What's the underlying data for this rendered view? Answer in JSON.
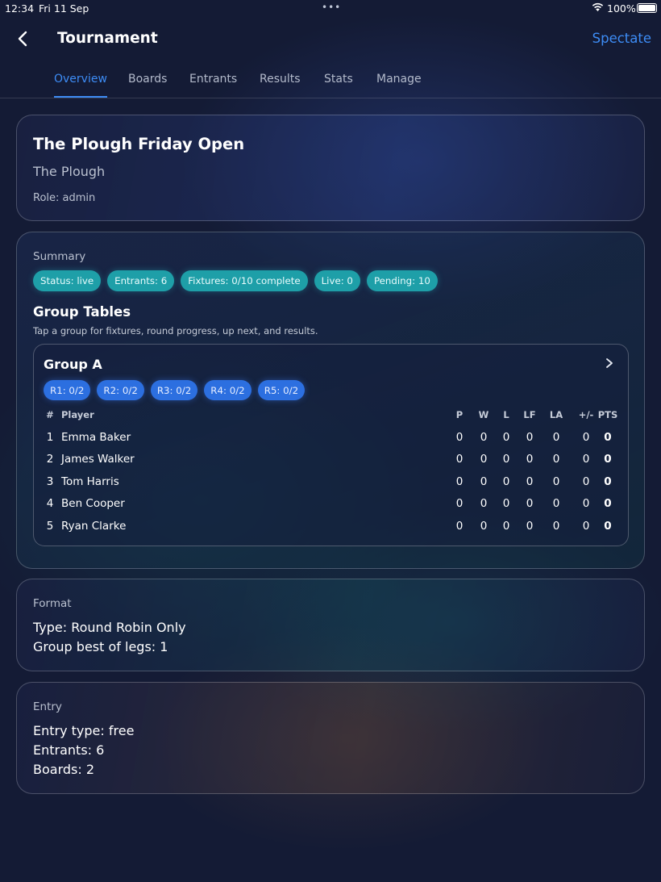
{
  "status_bar": {
    "time": "12:34",
    "date": "Fri 11 Sep",
    "dots": "•••",
    "battery": "100%"
  },
  "nav": {
    "title": "Tournament",
    "action": "Spectate"
  },
  "tabs": [
    {
      "label": "Overview",
      "active": true
    },
    {
      "label": "Boards"
    },
    {
      "label": "Entrants"
    },
    {
      "label": "Results"
    },
    {
      "label": "Stats"
    },
    {
      "label": "Manage"
    }
  ],
  "header": {
    "title": "The Plough Friday Open",
    "venue": "The Plough",
    "role": "Role: admin"
  },
  "summary": {
    "label": "Summary",
    "pills": [
      "Status: live",
      "Entrants: 6",
      "Fixtures: 0/10 complete",
      "Live: 0",
      "Pending: 10"
    ],
    "group_tables_title": "Group Tables",
    "group_tables_hint": "Tap a group for fixtures, round progress, up next, and results."
  },
  "group": {
    "name": "Group A",
    "rounds": [
      "R1: 0/2",
      "R2: 0/2",
      "R3: 0/2",
      "R4: 0/2",
      "R5: 0/2"
    ],
    "columns": {
      "num": "#",
      "player": "Player",
      "p": "P",
      "w": "W",
      "l": "L",
      "lf": "LF",
      "la": "LA",
      "pm": "+/-",
      "pts": "PTS"
    },
    "rows": [
      {
        "num": "1",
        "player": "Emma Baker",
        "p": "0",
        "w": "0",
        "l": "0",
        "lf": "0",
        "la": "0",
        "pm": "0",
        "pts": "0"
      },
      {
        "num": "2",
        "player": "James Walker",
        "p": "0",
        "w": "0",
        "l": "0",
        "lf": "0",
        "la": "0",
        "pm": "0",
        "pts": "0"
      },
      {
        "num": "3",
        "player": "Tom Harris",
        "p": "0",
        "w": "0",
        "l": "0",
        "lf": "0",
        "la": "0",
        "pm": "0",
        "pts": "0"
      },
      {
        "num": "4",
        "player": "Ben Cooper",
        "p": "0",
        "w": "0",
        "l": "0",
        "lf": "0",
        "la": "0",
        "pm": "0",
        "pts": "0"
      },
      {
        "num": "5",
        "player": "Ryan Clarke",
        "p": "0",
        "w": "0",
        "l": "0",
        "lf": "0",
        "la": "0",
        "pm": "0",
        "pts": "0"
      }
    ]
  },
  "format": {
    "label": "Format",
    "type": "Type: Round Robin Only",
    "legs": "Group best of legs: 1"
  },
  "entry": {
    "label": "Entry",
    "type": "Entry type: free",
    "entrants": "Entrants: 6",
    "boards": "Boards: 2"
  },
  "colors": {
    "accent": "#3d8cf5",
    "pill": "#1e9fa8",
    "round_pill": "#2c6fe0",
    "background": "#141b35"
  }
}
